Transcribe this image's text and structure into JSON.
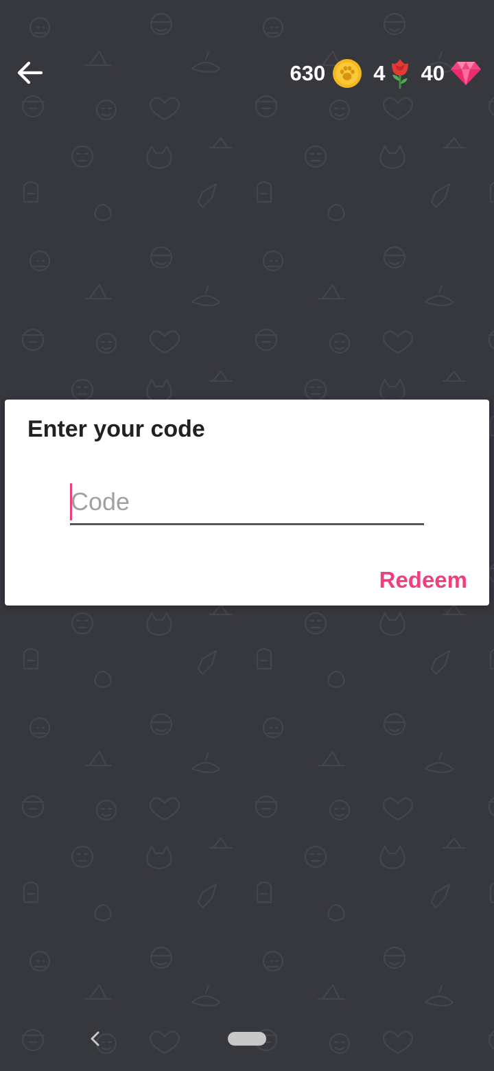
{
  "header": {
    "back_icon": "arrow-left-icon",
    "wallet": {
      "coins": "630",
      "coins_icon": "paw-coin-icon",
      "roses": "4",
      "roses_icon": "rose-icon",
      "gems": "40",
      "gems_icon": "diamond-icon"
    }
  },
  "dialog": {
    "title": "Enter your code",
    "input_placeholder": "Code",
    "input_value": "",
    "redeem_label": "Redeem"
  },
  "navigation_bar": {
    "back_icon": "chevron-left-icon",
    "home_icon": "home-pill-icon"
  },
  "colors": {
    "background": "#37383e",
    "accent": "#ef3f7f",
    "coin": "#f5b81c",
    "gem": "#f0447f"
  }
}
